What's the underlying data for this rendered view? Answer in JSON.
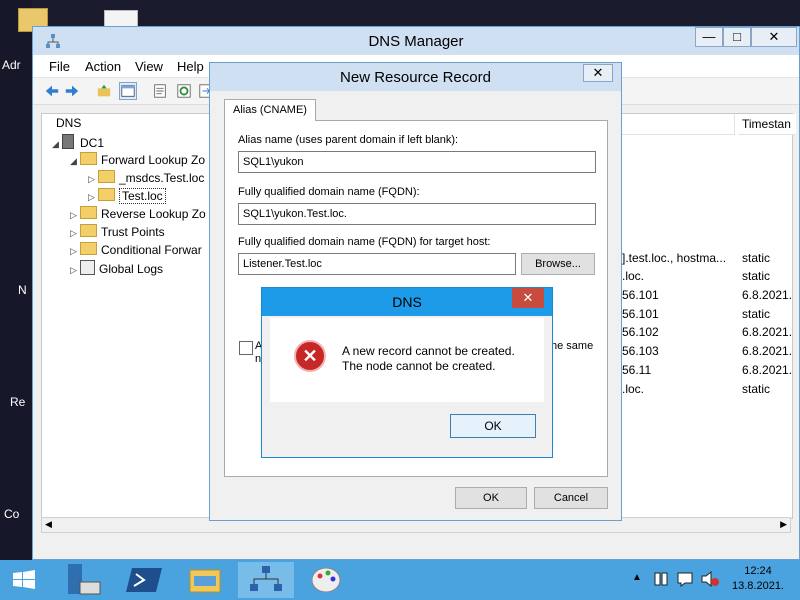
{
  "desktop": {
    "labels": [
      "Adr",
      "N",
      "Re",
      "Co"
    ]
  },
  "dns_manager": {
    "title": "DNS Manager",
    "menu": [
      "File",
      "Action",
      "View",
      "Help"
    ],
    "tree": {
      "root": "DNS",
      "server": "DC1",
      "forward_zones": "Forward Lookup Zo",
      "msdcs": "_msdcs.Test.loc",
      "test_loc": "Test.loc",
      "reverse_zones": "Reverse Lookup Zo",
      "trust_points": "Trust Points",
      "conditional": "Conditional Forwar",
      "global_logs": "Global Logs"
    },
    "list": {
      "timestamp_header": "Timestan",
      "rows": [
        {
          "data": "].test.loc., hostma...",
          "timestamp": "static"
        },
        {
          "data": ".loc.",
          "timestamp": "static"
        },
        {
          "data": "56.101",
          "timestamp": "6.8.2021."
        },
        {
          "data": "56.101",
          "timestamp": "static"
        },
        {
          "data": "56.102",
          "timestamp": "6.8.2021."
        },
        {
          "data": "56.103",
          "timestamp": "6.8.2021."
        },
        {
          "data": "56.11",
          "timestamp": "6.8.2021."
        },
        {
          "data": ".loc.",
          "timestamp": "static"
        }
      ]
    }
  },
  "new_record_dialog": {
    "title": "New Resource Record",
    "tab": "Alias (CNAME)",
    "alias_label": "Alias name (uses parent domain if left blank):",
    "alias_value": "SQL1\\yukon",
    "fqdn_label": "Fully qualified domain name (FQDN):",
    "fqdn_value": "SQL1\\yukon.Test.loc.",
    "target_label": "Fully qualified domain name (FQDN) for target host:",
    "target_value": "Listener.Test.loc",
    "browse": "Browse...",
    "checkbox_left": "A",
    "checkbox_left2": "n",
    "checkbox_right": "he same",
    "ok": "OK",
    "cancel": "Cancel"
  },
  "error_box": {
    "title": "DNS",
    "line1": "A new record cannot be created.",
    "line2": "The node cannot be created.",
    "ok": "OK",
    "icon": "error-icon"
  },
  "taskbar": {
    "time": "12:24",
    "date": "13.8.2021."
  },
  "colors": {
    "taskbar": "#4aa3df",
    "titlebar": "#cfe0f3",
    "error_titlebar": "#1e9be8",
    "error_icon": "#c62828"
  }
}
